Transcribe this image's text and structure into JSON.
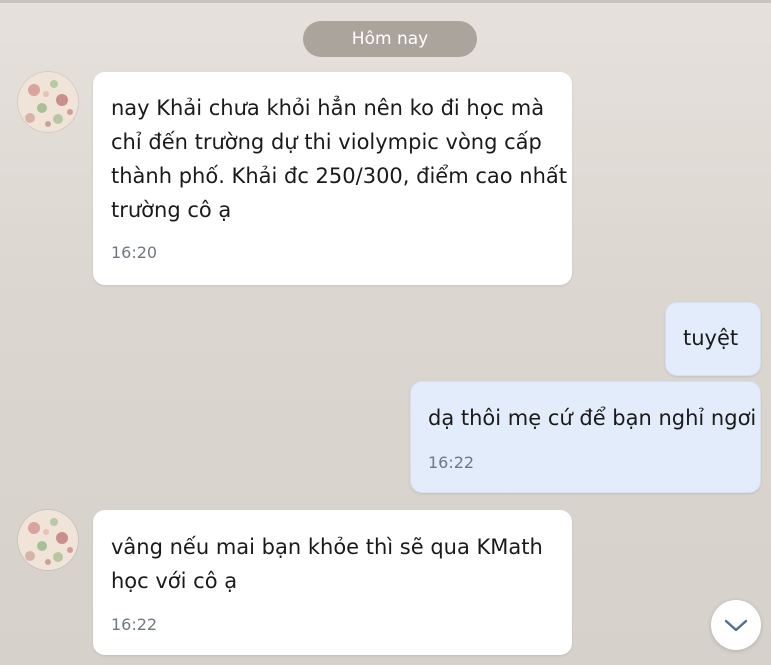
{
  "date_separator": "Hôm nay",
  "messages": [
    {
      "direction": "incoming",
      "lines": [
        "nay Khải chưa khỏi hẳn nên ko đi học mà",
        "chỉ đến trường dự thi violympic vòng cấp",
        "thành phố. Khải đc 250/300, điểm cao nhất",
        "trường cô ạ"
      ],
      "time": "16:20"
    },
    {
      "direction": "outgoing",
      "lines": [
        "tuyệt"
      ],
      "time": ""
    },
    {
      "direction": "outgoing",
      "lines": [
        "dạ thôi mẹ cứ để bạn nghỉ ngơi"
      ],
      "time": "16:22"
    },
    {
      "direction": "incoming",
      "lines": [
        "vâng nếu mai bạn khỏe thì sẽ qua KMath",
        "học với cô ạ"
      ],
      "time": "16:22"
    }
  ],
  "icons": {
    "avatar": "floral-avatar-icon",
    "scroll_down": "chevron-down-icon"
  },
  "colors": {
    "background": "#dcd6d0",
    "date_pill": "#aba49d",
    "incoming_bubble": "#ffffff",
    "outgoing_bubble": "#e3ecfb",
    "time_text": "#6f7881"
  }
}
